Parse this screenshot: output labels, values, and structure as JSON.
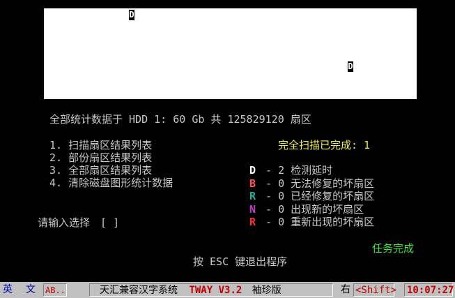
{
  "map": {
    "marker_char": "D"
  },
  "summary": {
    "text": "全部统计数据于 HDD 1: 60 Gb 共 125829120 扇区"
  },
  "menu": {
    "items": [
      "1. 扫描扇区结果列表",
      "2. 部份扇区结果列表",
      "3. 全部扇区结果列表",
      "4. 清除磁盘图形统计数据"
    ]
  },
  "scan_status": "完全扫描已完成: 1",
  "legend": {
    "dash": "-",
    "items": [
      {
        "symbol": "D",
        "count": "2",
        "label": "检测延时",
        "color": "#ffffff"
      },
      {
        "symbol": "B",
        "count": "0",
        "label": "无法修复的坏扇区",
        "color": "#ff5050"
      },
      {
        "symbol": "R",
        "count": "0",
        "label": "已经修复的坏扇区",
        "color": "#20b0a0"
      },
      {
        "symbol": "N",
        "count": "0",
        "label": "出现新的坏扇区",
        "color": "#c040c0"
      },
      {
        "symbol": "R",
        "count": "0",
        "label": "重新出现的坏扇区",
        "color": "#ff3030"
      }
    ]
  },
  "prompt": {
    "label": "请输入选择",
    "value": "[ ]"
  },
  "task_done": "任务完成",
  "exit_hint": "按 ESC 键退出程序",
  "statusbar": {
    "ime_en": "英",
    "ime_text": "文",
    "ab_mode": "AB..",
    "system_name": "天汇兼容汉字系统",
    "version": "TWAY V3.2",
    "edition": "袖珍版",
    "right_char": "右",
    "shift": "<Shift>",
    "clock": "10:07:27"
  },
  "colors": {
    "text": "#c8c8c8",
    "yellow": "#f0f050",
    "green": "#40e040",
    "status_red": "#c00000",
    "status_blue": "#0000a0",
    "status_bg": "#c0c0c0"
  }
}
